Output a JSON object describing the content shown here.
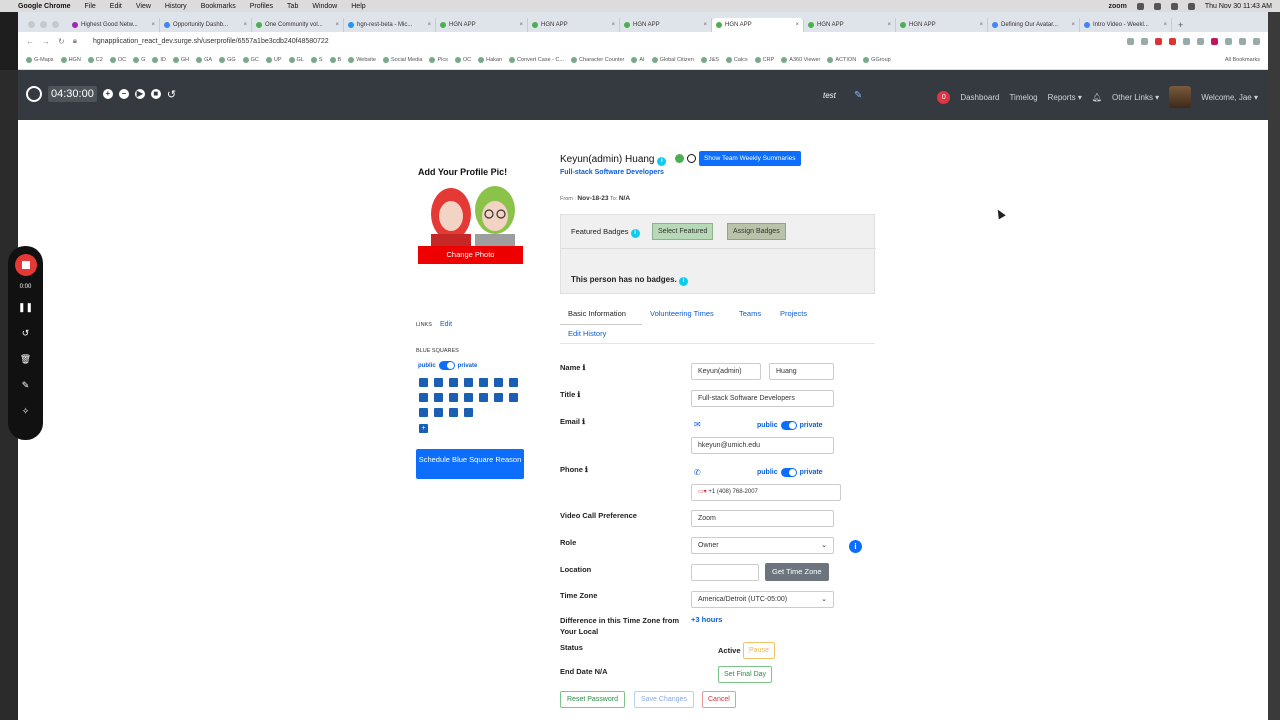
{
  "macos": {
    "app_name": "Google Chrome",
    "menus": [
      "File",
      "Edit",
      "View",
      "History",
      "Bookmarks",
      "Profiles",
      "Tab",
      "Window",
      "Help"
    ],
    "status_app": "zoom",
    "datetime": "Thu Nov 30  11:43 AM"
  },
  "browser": {
    "tabs": [
      {
        "label": "Highest Good Netw..."
      },
      {
        "label": "Opportunity Dashb..."
      },
      {
        "label": "One Community vol..."
      },
      {
        "label": "hgn-rest-beta - Mic..."
      },
      {
        "label": "HGN APP"
      },
      {
        "label": "HGN APP"
      },
      {
        "label": "HGN APP"
      },
      {
        "label": "HGN APP"
      },
      {
        "label": "HGN APP"
      },
      {
        "label": "HGN APP"
      },
      {
        "label": "Defining Our Avatar..."
      },
      {
        "label": "Intro Video - Weekl..."
      }
    ],
    "active_tab_index": 7,
    "url": "hgnapplication_react_dev.surge.sh/userprofile/6557a1be3cdb240f48580722",
    "bookmarks": [
      "G-Maps",
      "HGN",
      "C2",
      "OC",
      "G",
      "ID",
      "GH",
      "GA",
      "GG",
      "GC",
      "UP",
      "GL",
      "S",
      "B",
      "Website",
      "Social Media",
      "Pics",
      "OC",
      "Hakan",
      "Convert Case - C...",
      "Character Counter",
      "AI",
      "Global Citizen",
      "J&S",
      "Calcs",
      "CRP",
      "A360 Viewer",
      "ACTION",
      "GGroup"
    ],
    "all_bookmarks": "All Bookmarks"
  },
  "navbar": {
    "timer": "04:30:00",
    "test_label": "test",
    "notification_count": "0",
    "links": [
      "Dashboard",
      "Timelog",
      "Reports",
      "Other Links"
    ],
    "welcome": "Welcome, Jae"
  },
  "recorder": {
    "time": "0:00"
  },
  "profile": {
    "add_pic_title": "Add Your Profile Pic!",
    "change_photo": "Change Photo",
    "links_label": "LINKS",
    "links_edit": "Edit",
    "blue_squares_label": "BLUE SQUARES",
    "public_label": "public",
    "private_label": "private",
    "blue_square_count": 18,
    "add_square": "+",
    "schedule_reason": "Schedule Blue Square Reason"
  },
  "user": {
    "name": "Keyun(admin) Huang",
    "weekly_summaries_button": "Show Team Weekly Summaries",
    "job_title": "Full-stack Software Developers",
    "from_label": "From :",
    "from_date": "Nov-18-23",
    "to_label": "To:",
    "to_date": "N/A"
  },
  "badges": {
    "featured_label": "Featured Badges",
    "select_featured": "Select Featured",
    "assign_badges": "Assign Badges",
    "no_badges_text": "This person has no badges."
  },
  "tabs": [
    "Basic Information",
    "Volunteering Times",
    "Teams",
    "Projects",
    "Edit History"
  ],
  "form": {
    "name_label": "Name",
    "first_name": "Keyun(admin)",
    "last_name": "Huang",
    "title_label": "Title",
    "title_value": "Full-stack Software Developers",
    "email_label": "Email",
    "email_value": "hkeyun@umich.edu",
    "phone_label": "Phone",
    "phone_value": "+1 (408) 768-2007",
    "video_label": "Video Call Preference",
    "video_value": "Zoom",
    "role_label": "Role",
    "role_value": "Owner",
    "location_label": "Location",
    "location_value": "",
    "get_time_zone": "Get Time Zone",
    "tz_label": "Time Zone",
    "tz_value": "America/Detroit (UTC-05:00)",
    "diff_label": "Difference in this Time Zone from Your Local",
    "diff_value": "+3 hours",
    "status_label": "Status",
    "status_value": "Active",
    "pause": "Pause",
    "end_date_label": "End Date N/A",
    "set_final_day": "Set Final Day",
    "reset_password": "Reset Password",
    "save_changes": "Save Changes",
    "cancel": "Cancel"
  },
  "colors": {
    "navbar": "#343a40",
    "primary": "#0d6efd",
    "danger": "#e00000",
    "link": "#0b5ed7"
  }
}
